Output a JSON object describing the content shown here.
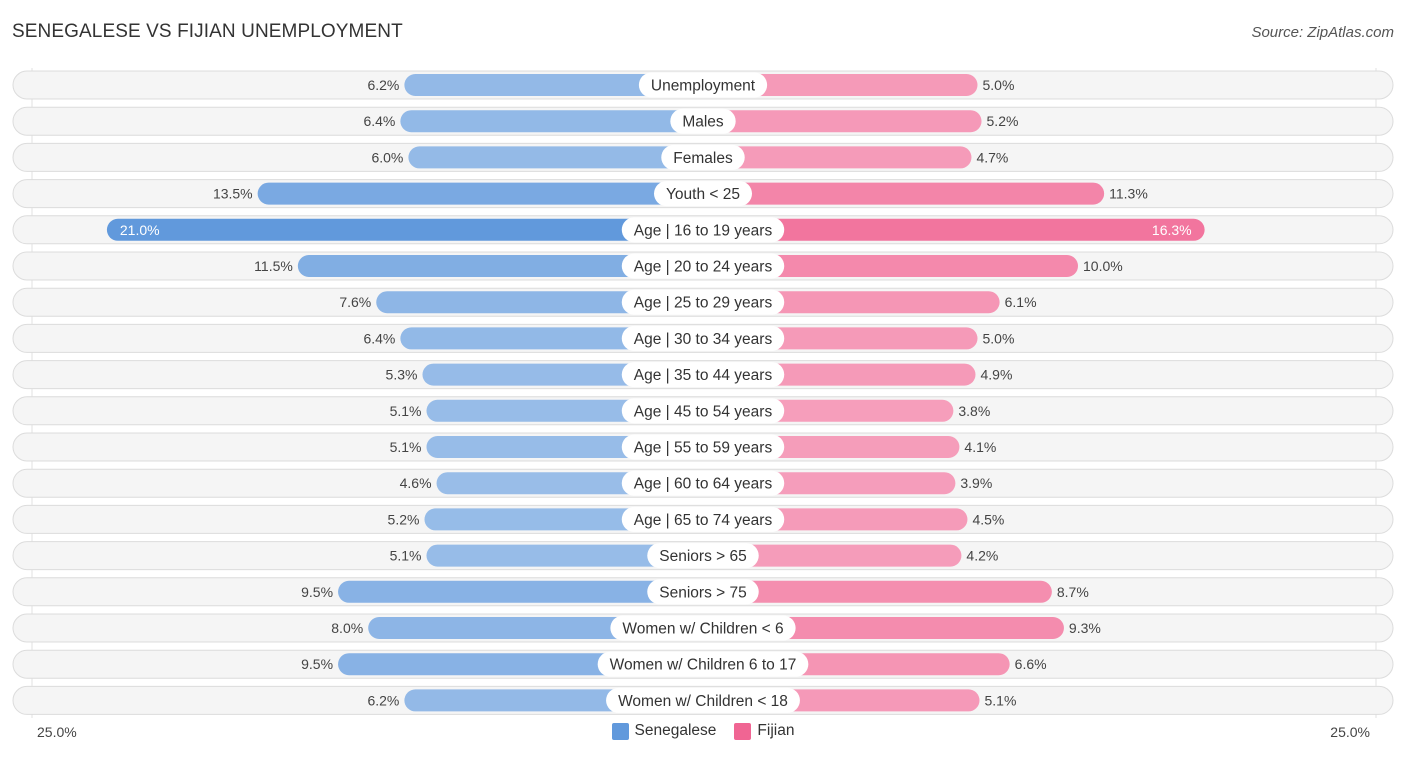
{
  "header": {
    "title": "SENEGALESE VS FIJIAN UNEMPLOYMENT",
    "source": "Source: ZipAtlas.com"
  },
  "legend": {
    "items": [
      {
        "name": "Senegalese",
        "color": "#6199dc"
      },
      {
        "name": "Fijian",
        "color": "#f06593"
      }
    ]
  },
  "axis": {
    "left_label": "25.0%",
    "right_label": "25.0%"
  },
  "chart_data": {
    "type": "bar",
    "orientation": "horizontal-diverging",
    "title": "SENEGALESE VS FIJIAN UNEMPLOYMENT",
    "xlabel": "",
    "ylabel": "",
    "xlim": [
      0,
      25
    ],
    "unit": "%",
    "legend_position": "bottom-center",
    "categories": [
      "Unemployment",
      "Males",
      "Females",
      "Youth < 25",
      "Age | 16 to 19 years",
      "Age | 20 to 24 years",
      "Age | 25 to 29 years",
      "Age | 30 to 34 years",
      "Age | 35 to 44 years",
      "Age | 45 to 54 years",
      "Age | 55 to 59 years",
      "Age | 60 to 64 years",
      "Age | 65 to 74 years",
      "Seniors > 65",
      "Seniors > 75",
      "Women w/ Children < 6",
      "Women w/ Children 6 to 17",
      "Women w/ Children < 18"
    ],
    "series": [
      {
        "name": "Senegalese",
        "color": "#6199dc",
        "values": [
          6.2,
          6.4,
          6.0,
          13.5,
          21.0,
          11.5,
          7.6,
          6.4,
          5.3,
          5.1,
          5.1,
          4.6,
          5.2,
          5.1,
          9.5,
          8.0,
          9.5,
          6.2
        ]
      },
      {
        "name": "Fijian",
        "color": "#f06593",
        "values": [
          5.0,
          5.2,
          4.7,
          11.3,
          16.3,
          10.0,
          6.1,
          5.0,
          4.9,
          3.8,
          4.1,
          3.9,
          4.5,
          4.2,
          8.7,
          9.3,
          6.6,
          5.1
        ]
      }
    ]
  }
}
